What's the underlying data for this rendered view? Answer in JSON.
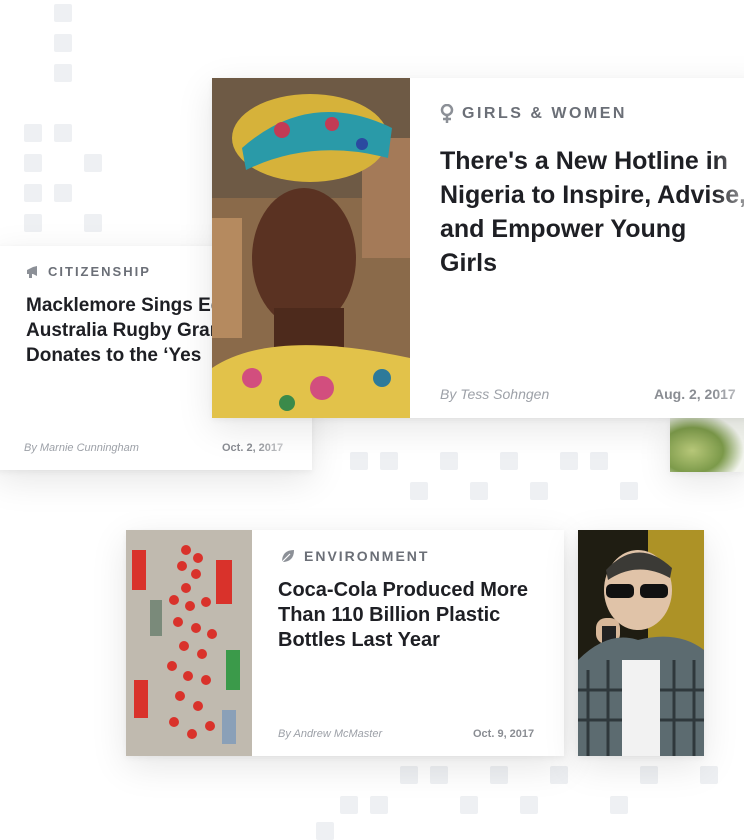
{
  "cards": [
    {
      "category": "Citizenship",
      "category_icon": "megaphone-icon",
      "title": "Macklemore Sings Equality at Australia Rugby Grand Final and Donates to the ‘Yes",
      "author": "By Marnie Cunningham",
      "date": "Oct. 2, 2017"
    },
    {
      "category": "Girls & Women",
      "category_icon": "female-symbol-icon",
      "title": "There's a New Hotline in Nigeria to Inspire, Advise, and Empower Young Girls",
      "author": "By Tess Sohngen",
      "date": "Aug. 2, 2017",
      "image": "young-woman-in-headwrap-photo"
    },
    {
      "category": "Environment",
      "category_icon": "leaf-icon",
      "title": "Coca-Cola Produced More Than 110 Billion Plastic Bottles Last Year",
      "author": "By Andrew McMaster",
      "date": "Oct. 9, 2017",
      "image": "plastic-bottles-and-caps-photo"
    },
    {
      "image": "performer-in-sunglasses-photo"
    }
  ],
  "colors": {
    "title": "#1e1f24",
    "category": "#6b6f77",
    "byline": "#9da1a8"
  }
}
